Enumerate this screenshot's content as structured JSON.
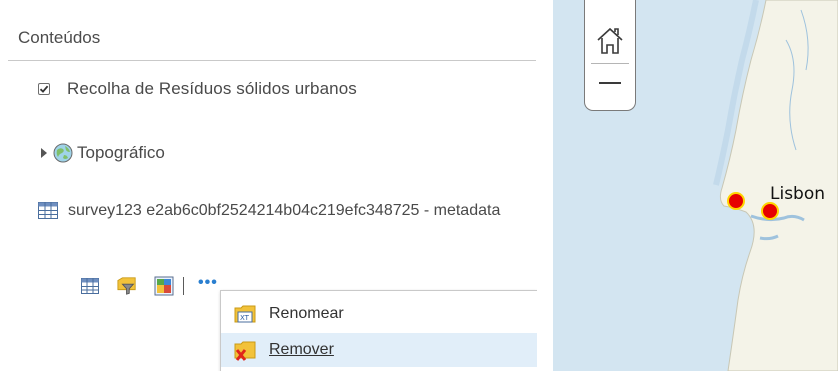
{
  "panel": {
    "title": "Conteúdos",
    "layers": {
      "recolha": {
        "label": "Recolha de Resíduos sólidos urbanos",
        "checked": true
      },
      "topo": {
        "label": "Topográfico"
      },
      "survey": {
        "name": "survey123 e2ab6c0bf2524214b04c219efc348725 - metadata"
      }
    },
    "tools": {
      "table_icon": "table-icon",
      "filter_icon": "filter-icon",
      "style_icon": "style-icon",
      "more_label": "•••"
    }
  },
  "context_menu": {
    "items": [
      {
        "label": "Renomear",
        "icon": "rename-icon"
      },
      {
        "label": "Remover",
        "icon": "remove-icon"
      }
    ]
  },
  "map": {
    "city_label": "Lisbon",
    "home_icon": "home-icon",
    "zoom_out_icon": "minus-icon",
    "marker_color": "#e60000",
    "marker_border": "#ffd400",
    "water_color": "#d3e5f1",
    "land_color": "#f4f3e8"
  },
  "colors": {
    "link": "#2a7fd0",
    "menu_hover": "#e1eef9"
  }
}
